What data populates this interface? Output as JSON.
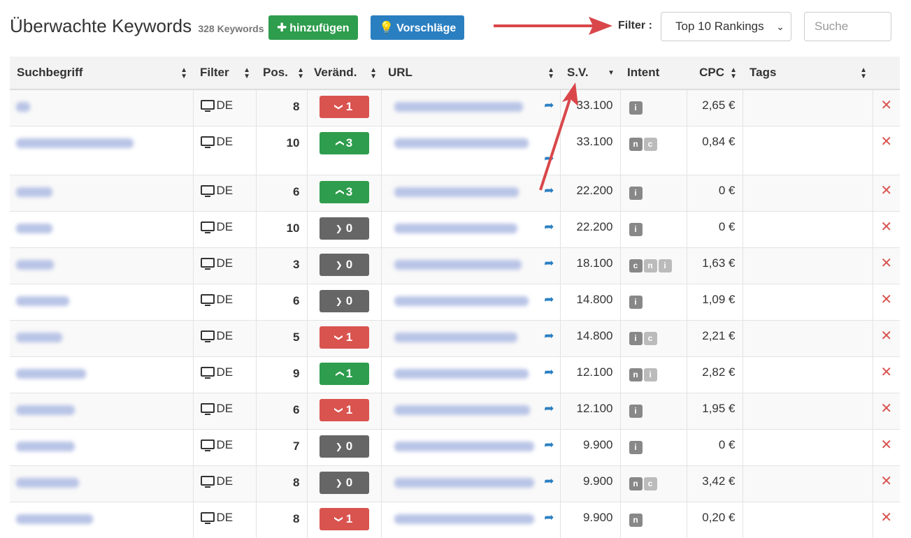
{
  "header": {
    "title": "Überwachte Keywords",
    "count": "328 Keywords",
    "add_button": "hinzufügen",
    "suggestions_button": "Vorschläge",
    "filter_label": "Filter :",
    "filter_value": "Top 10 Rankings",
    "search_placeholder": "Suche"
  },
  "columns": [
    "Suchbegriff",
    "Filter",
    "Pos.",
    "Veränd.",
    "URL",
    "S.V.",
    "Intent",
    "CPC",
    "Tags"
  ],
  "rows": [
    {
      "filter": "DE",
      "pos": "8",
      "change": "1",
      "dir": "down",
      "sv": "33.100",
      "intent": [
        "i"
      ],
      "cpc": "2,65 €"
    },
    {
      "filter": "DE",
      "pos": "10",
      "change": "3",
      "dir": "up",
      "sv": "33.100",
      "intent": [
        "n",
        "c"
      ],
      "cpc": "0,84 €"
    },
    {
      "filter": "DE",
      "pos": "6",
      "change": "3",
      "dir": "up",
      "sv": "22.200",
      "intent": [
        "i"
      ],
      "cpc": "0 €"
    },
    {
      "filter": "DE",
      "pos": "10",
      "change": "0",
      "dir": "same",
      "sv": "22.200",
      "intent": [
        "i"
      ],
      "cpc": "0 €"
    },
    {
      "filter": "DE",
      "pos": "3",
      "change": "0",
      "dir": "same",
      "sv": "18.100",
      "intent": [
        "c",
        "n",
        "i"
      ],
      "cpc": "1,63 €"
    },
    {
      "filter": "DE",
      "pos": "6",
      "change": "0",
      "dir": "same",
      "sv": "14.800",
      "intent": [
        "i"
      ],
      "cpc": "1,09 €"
    },
    {
      "filter": "DE",
      "pos": "5",
      "change": "1",
      "dir": "down",
      "sv": "14.800",
      "intent": [
        "i",
        "c"
      ],
      "cpc": "2,21 €"
    },
    {
      "filter": "DE",
      "pos": "9",
      "change": "1",
      "dir": "up",
      "sv": "12.100",
      "intent": [
        "n",
        "i"
      ],
      "cpc": "2,82 €"
    },
    {
      "filter": "DE",
      "pos": "6",
      "change": "1",
      "dir": "down",
      "sv": "12.100",
      "intent": [
        "i"
      ],
      "cpc": "1,95 €"
    },
    {
      "filter": "DE",
      "pos": "7",
      "change": "0",
      "dir": "same",
      "sv": "9.900",
      "intent": [
        "i"
      ],
      "cpc": "0 €"
    },
    {
      "filter": "DE",
      "pos": "8",
      "change": "0",
      "dir": "same",
      "sv": "9.900",
      "intent": [
        "n",
        "c"
      ],
      "cpc": "3,42 €"
    },
    {
      "filter": "DE",
      "pos": "8",
      "change": "1",
      "dir": "down",
      "sv": "9.900",
      "intent": [
        "n"
      ],
      "cpc": "0,20 €"
    }
  ],
  "colors": {
    "green": "#2e9d4d",
    "blue": "#2a7fc1",
    "red": "#d9534f",
    "gray": "#666666",
    "annotation_arrow": "#d9474a"
  },
  "icons": {
    "device": "monitor-icon",
    "share": "share-icon",
    "delete": "times-icon",
    "add": "plus-icon",
    "suggestions": "lightbulb-icon"
  }
}
